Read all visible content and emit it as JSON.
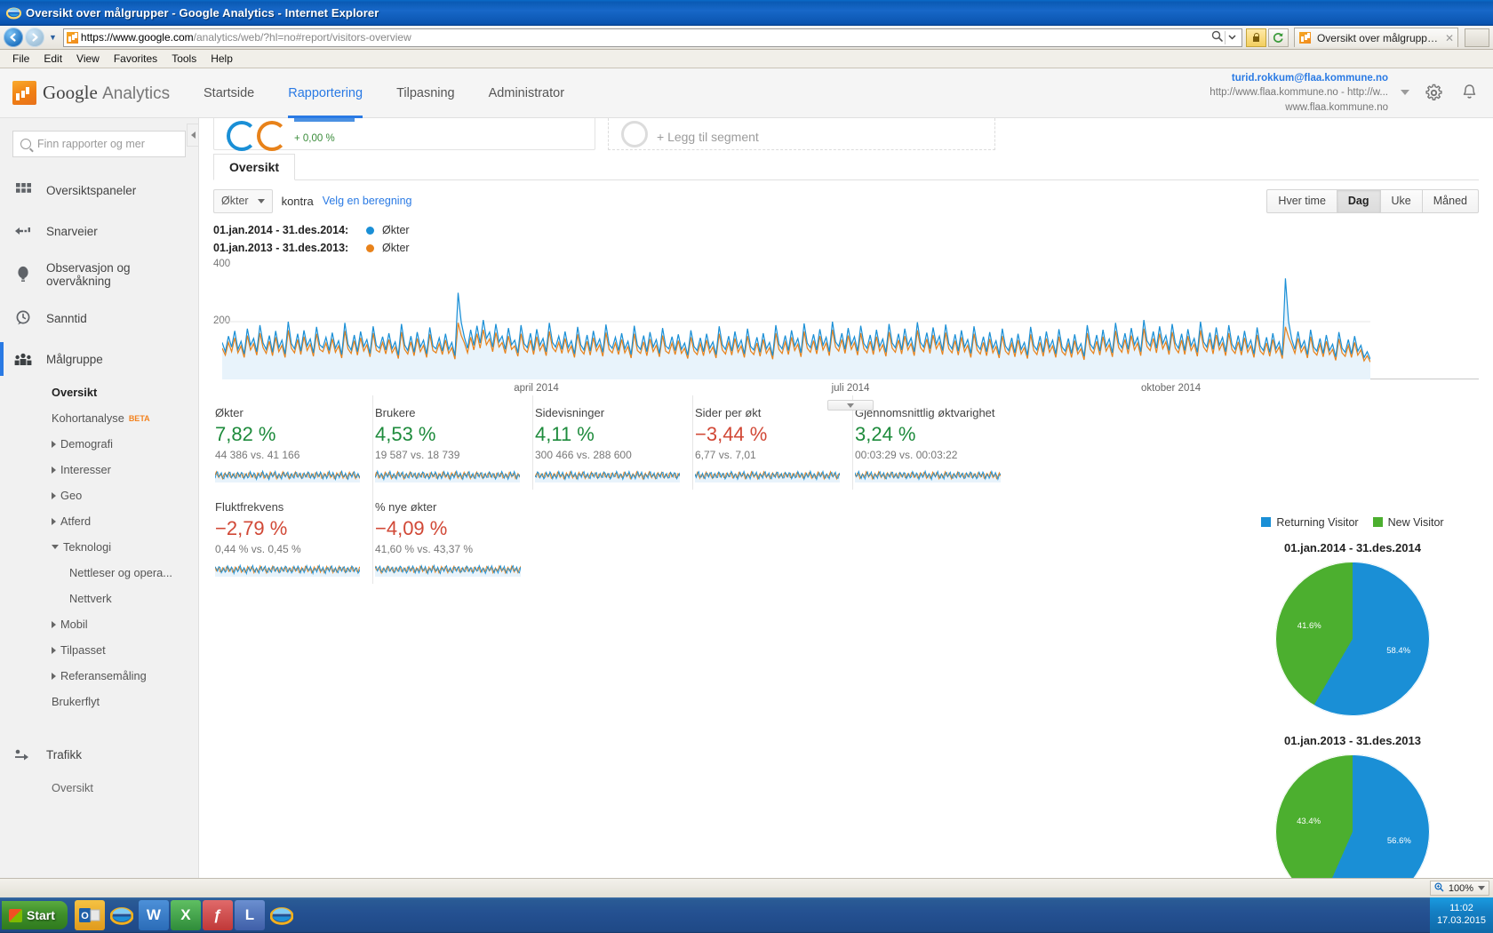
{
  "window": {
    "title": "Oversikt over målgrupper - Google Analytics - Internet Explorer",
    "url_host": "https://www.google.com",
    "url_path": "/analytics/web/?hl=no#report/visitors-overview",
    "tab_label": "Oversikt over målgrupper - G...",
    "tab_close": "✕",
    "menu": [
      "File",
      "Edit",
      "View",
      "Favorites",
      "Tools",
      "Help"
    ],
    "zoom_level": "100%",
    "status_zoom_icon": "magnifier-icon"
  },
  "taskbar": {
    "start_label": "Start",
    "clock_time": "11:02",
    "clock_date": "17.03.2015",
    "apps": [
      "outlook",
      "internet-explorer",
      "word",
      "excel",
      "f-app",
      "l-app",
      "internet-explorer-2"
    ]
  },
  "header": {
    "logo_google": "Google",
    "logo_analytics": "Analytics",
    "nav": [
      {
        "label": "Startside",
        "active": false
      },
      {
        "label": "Rapportering",
        "active": true
      },
      {
        "label": "Tilpasning",
        "active": false
      },
      {
        "label": "Administrator",
        "active": false
      }
    ],
    "account_email": "turid.rokkum@flaa.kommune.no",
    "account_property": "http://www.flaa.kommune.no - http://w...",
    "account_view": "www.flaa.kommune.no",
    "settings_icon": "gear-icon",
    "notifications_icon": "bell-icon"
  },
  "sidebar": {
    "search_placeholder": "Finn rapporter og mer",
    "items": [
      {
        "label": "Oversiktspaneler",
        "icon": "grid-icon"
      },
      {
        "label": "Snarveier",
        "icon": "arrow-left-dashed-icon"
      },
      {
        "label": "Observasjon og overvåkning",
        "icon": "balloon-icon"
      },
      {
        "label": "Sanntid",
        "icon": "clock-bubble-icon"
      },
      {
        "label": "Målgruppe",
        "icon": "people-icon",
        "selected": true
      }
    ],
    "sub_items": [
      {
        "label": "Oversikt",
        "bold": true
      },
      {
        "label": "Kohortanalyse",
        "badge": "BETA"
      },
      {
        "label": "Demografi",
        "arrow": "right"
      },
      {
        "label": "Interesser",
        "arrow": "right"
      },
      {
        "label": "Geo",
        "arrow": "right"
      },
      {
        "label": "Atferd",
        "arrow": "right"
      },
      {
        "label": "Teknologi",
        "arrow": "down"
      },
      {
        "label": "Nettleser og opera...",
        "indent": true
      },
      {
        "label": "Nettverk",
        "indent": true
      },
      {
        "label": "Mobil",
        "arrow": "right"
      },
      {
        "label": "Tilpasset",
        "arrow": "right"
      },
      {
        "label": "Referansemåling",
        "arrow": "right"
      },
      {
        "label": "Brukerflyt"
      }
    ],
    "footer_items": [
      {
        "label": "Trafikk",
        "icon": "traffic-icon"
      },
      {
        "label": "Oversikt",
        "sub": true
      }
    ],
    "collapse_icon": "chevron-left-icon"
  },
  "segments": {
    "all_sessions_pct": "+ 0,00 %",
    "add_segment_label": "+ Legg til segment"
  },
  "report": {
    "tab_label": "Oversikt",
    "metric_select": "Økter",
    "kontra_label": "kontra",
    "select_calc_link": "Velg en beregning",
    "granularity": [
      {
        "label": "Hver time",
        "active": false
      },
      {
        "label": "Dag",
        "active": true
      },
      {
        "label": "Uke",
        "active": false
      },
      {
        "label": "Måned",
        "active": false
      }
    ],
    "legend": [
      {
        "date": "01.jan.2014 - 31.des.2014:",
        "series": "Økter",
        "color": "#1a8fd6"
      },
      {
        "date": "01.jan.2013 - 31.des.2013:",
        "series": "Økter",
        "color": "#e8821a"
      }
    ]
  },
  "chart_data": {
    "type": "line",
    "title": "Økter",
    "xlabel": "",
    "ylabel": "Økter",
    "ylim": [
      0,
      400
    ],
    "yticks": [
      200,
      400
    ],
    "xticks": [
      "april 2014",
      "juli 2014",
      "oktober 2014"
    ],
    "grid": false,
    "legend_position": "above",
    "series": [
      {
        "name": "Økter 01.jan.2014 - 31.des.2014",
        "color": "#1a8fd6",
        "values": [
          128,
          96,
          150,
          112,
          168,
          104,
          132,
          88,
          176,
          118,
          142,
          96,
          188,
          126,
          104,
          152,
          94,
          168,
          110,
          136,
          88,
          200,
          124,
          106,
          158,
          98,
          170,
          116,
          140,
          92,
          182,
          120,
          110,
          146,
          100,
          162,
          108,
          134,
          86,
          196,
          122,
          102,
          154,
          96,
          166,
          114,
          138,
          90,
          184,
          118,
          108,
          148,
          102,
          160,
          106,
          130,
          84,
          192,
          120,
          100,
          150,
          94,
          164,
          112,
          136,
          88,
          180,
          116,
          106,
          144,
          98,
          158,
          104,
          128,
          82,
          300,
          198,
          146,
          108,
          172,
          118,
          186,
          126,
          206,
          142,
          164,
          112,
          192,
          130,
          150,
          104,
          178,
          120,
          136,
          92,
          188,
          124,
          110,
          160,
          100,
          174,
          118,
          142,
          96,
          196,
          128,
          112,
          150,
          104,
          166,
          110,
          134,
          88,
          182,
          120,
          102,
          154,
          98,
          168,
          114,
          140,
          94,
          190,
          122,
          108,
          146,
          100,
          160,
          106,
          132,
          86,
          186,
          118,
          104,
          152,
          96,
          164,
          112,
          138,
          90,
          178,
          116,
          106,
          148,
          100,
          156,
          104,
          126,
          84,
          170,
          114,
          100,
          144,
          96,
          158,
          108,
          130,
          86,
          184,
          120,
          104,
          150,
          98,
          166,
          110,
          136,
          88,
          176,
          114,
          102,
          146,
          94,
          160,
          106,
          128,
          82,
          188,
          122,
          106,
          152,
          100,
          170,
          116,
          142,
          92,
          194,
          126,
          110,
          156,
          102,
          174,
          118,
          146,
          96,
          200,
          130,
          114,
          160,
          104,
          178,
          120,
          148,
          98,
          186,
          124,
          108,
          154,
          100,
          172,
          114,
          140,
          94,
          192,
          126,
          110,
          158,
          102,
          176,
          118,
          144,
          96,
          198,
          128,
          112,
          162,
          106,
          180,
          122,
          150,
          100,
          190,
          124,
          106,
          156,
          98,
          170,
          112,
          138,
          90,
          184,
          120,
          104,
          148,
          96,
          164,
          108,
          134,
          86,
          176,
          116,
          100,
          144,
          92,
          158,
          104,
          128,
          84,
          182,
          118,
          102,
          150,
          94,
          166,
          110,
          136,
          88,
          174,
          112,
          98,
          142,
          90,
          156,
          102,
          124,
          80,
          188,
          122,
          106,
          154,
          98,
          172,
          114,
          140,
          92,
          196,
          128,
          110,
          160,
          104,
          178,
          120,
          146,
          96,
          206,
          134,
          116,
          166,
          108,
          184,
          124,
          152,
          100,
          192,
          126,
          108,
          158,
          100,
          174,
          116,
          142,
          94,
          200,
          130,
          112,
          162,
          104,
          180,
          118,
          146,
          96,
          188,
          122,
          104,
          152,
          98,
          168,
          110,
          136,
          88,
          180,
          116,
          100,
          146,
          94,
          160,
          106,
          130,
          84,
          350,
          200,
          140,
          104,
          166,
          110,
          134,
          86,
          172,
          112,
          98,
          142,
          90,
          154,
          100,
          122,
          78,
          164,
          108,
          94,
          138,
          88,
          150,
          98,
          118,
          76,
          96,
          70
        ]
      },
      {
        "name": "Økter 01.jan.2013 - 31.des.2013",
        "color": "#e8821a",
        "values": [
          108,
          84,
          128,
          96,
          144,
          92,
          116,
          76,
          152,
          102,
          124,
          84,
          160,
          110,
          90,
          132,
          82,
          146,
          96,
          118,
          76,
          170,
          108,
          92,
          138,
          86,
          148,
          100,
          122,
          80,
          158,
          104,
          96,
          126,
          88,
          140,
          94,
          116,
          74,
          168,
          106,
          90,
          134,
          84,
          144,
          98,
          120,
          78,
          160,
          102,
          94,
          128,
          88,
          138,
          92,
          112,
          72,
          164,
          104,
          88,
          130,
          82,
          142,
          96,
          118,
          76,
          156,
          100,
          92,
          124,
          86,
          136,
          90,
          110,
          70,
          196,
          152,
          126,
          92,
          146,
          102,
          158,
          108,
          172,
          120,
          140,
          96,
          162,
          112,
          128,
          90,
          150,
          104,
          116,
          80,
          158,
          106,
          94,
          136,
          86,
          148,
          100,
          122,
          82,
          166,
          110,
          96,
          128,
          90,
          142,
          94,
          116,
          76,
          156,
          102,
          88,
          132,
          84,
          144,
          98,
          120,
          80,
          162,
          104,
          92,
          126,
          86,
          138,
          92,
          114,
          74,
          158,
          100,
          90,
          130,
          82,
          140,
          96,
          118,
          78,
          152,
          98,
          90,
          126,
          86,
          134,
          90,
          108,
          72,
          146,
          98,
          86,
          124,
          82,
          136,
          92,
          112,
          74,
          158,
          102,
          88,
          128,
          84,
          142,
          94,
          116,
          76,
          150,
          98,
          86,
          126,
          80,
          138,
          90,
          110,
          70,
          160,
          104,
          90,
          130,
          86,
          146,
          100,
          122,
          78,
          166,
          108,
          94,
          134,
          88,
          150,
          102,
          126,
          82,
          172,
          112,
          98,
          138,
          90,
          152,
          104,
          128,
          84,
          160,
          106,
          92,
          132,
          86,
          148,
          98,
          120,
          80,
          164,
          108,
          94,
          136,
          88,
          150,
          102,
          124,
          82,
          170,
          110,
          96,
          140,
          90,
          154,
          106,
          128,
          86,
          162,
          106,
          92,
          134,
          84,
          146,
          96,
          118,
          76,
          158,
          102,
          88,
          128,
          82,
          140,
          92,
          114,
          74,
          150,
          98,
          86,
          124,
          78,
          136,
          88,
          110,
          72,
          156,
          100,
          86,
          128,
          80,
          142,
          94,
          116,
          76,
          148,
          96,
          84,
          122,
          76,
          134,
          88,
          106,
          68,
          160,
          104,
          90,
          132,
          84,
          148,
          98,
          120,
          78,
          168,
          110,
          94,
          138,
          88,
          152,
          102,
          126,
          82,
          176,
          114,
          100,
          142,
          92,
          158,
          106,
          130,
          86,
          164,
          108,
          92,
          136,
          86,
          150,
          100,
          122,
          80,
          170,
          112,
          96,
          140,
          88,
          154,
          102,
          126,
          82,
          160,
          104,
          90,
          130,
          84,
          144,
          94,
          116,
          76,
          154,
          98,
          86,
          126,
          80,
          138,
          92,
          112,
          72,
          182,
          146,
          120,
          90,
          142,
          94,
          114,
          74,
          148,
          96,
          84,
          122,
          78,
          132,
          86,
          104,
          66,
          140,
          92,
          80,
          118,
          76,
          128,
          84,
          102,
          64,
          82,
          60
        ]
      }
    ]
  },
  "metrics": [
    {
      "name": "Økter",
      "value": "7,82 %",
      "dir": "up",
      "sub": "44 386 vs. 41 166"
    },
    {
      "name": "Brukere",
      "value": "4,53 %",
      "dir": "up",
      "sub": "19 587 vs. 18 739"
    },
    {
      "name": "Sidevisninger",
      "value": "4,11 %",
      "dir": "up",
      "sub": "300 466 vs. 288 600"
    },
    {
      "name": "Sider per økt",
      "value": "−3,44 %",
      "dir": "down",
      "sub": "6,77 vs. 7,01"
    },
    {
      "name": "Gjennomsnittlig øktvarighet",
      "value": "3,24 %",
      "dir": "up",
      "sub": "00:03:29 vs. 00:03:22"
    },
    {
      "name": "Fluktfrekvens",
      "value": "−2,79 %",
      "dir": "down",
      "sub": "0,44 % vs. 0,45 %"
    },
    {
      "name": "% nye økter",
      "value": "−4,09 %",
      "dir": "down",
      "sub": "41,60 % vs. 43,37 %"
    }
  ],
  "pies": {
    "legend": [
      {
        "label": "Returning Visitor",
        "color": "#1a8fd6"
      },
      {
        "label": "New Visitor",
        "color": "#4caf2f"
      }
    ],
    "charts": [
      {
        "title": "01.jan.2014 - 31.des.2014",
        "slices": [
          {
            "label": "58.4%",
            "value": 58.4,
            "color": "#1a8fd6"
          },
          {
            "label": "41.6%",
            "value": 41.6,
            "color": "#4caf2f"
          }
        ]
      },
      {
        "title": "01.jan.2013 - 31.des.2013",
        "slices": [
          {
            "label": "56.6%",
            "value": 56.6,
            "color": "#1a8fd6"
          },
          {
            "label": "43.4%",
            "value": 43.4,
            "color": "#4caf2f"
          }
        ]
      }
    ]
  }
}
